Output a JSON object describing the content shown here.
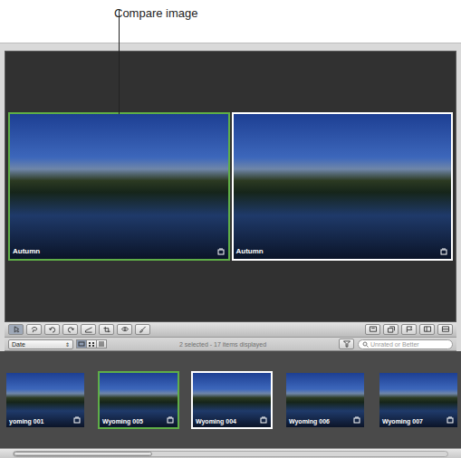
{
  "callout": {
    "label": "Compare image"
  },
  "viewer": {
    "images": [
      {
        "label": "Autumn",
        "compare": true,
        "selected": true
      },
      {
        "label": "Autumn",
        "compare": false,
        "selected": true
      }
    ]
  },
  "sort": {
    "value": "Date"
  },
  "view_modes": [
    {
      "selected": true
    },
    {
      "selected": false
    },
    {
      "selected": false
    }
  ],
  "status": "2 selected - 17 items displayed",
  "search": {
    "placeholder": "Unrated or Better"
  },
  "browser": {
    "thumbnails": [
      {
        "label": "yoming 001",
        "selected": false,
        "primary": false
      },
      {
        "label": "Wyoming 005",
        "selected": true,
        "primary": true
      },
      {
        "label": "Wyoming 004",
        "selected": true,
        "primary": false
      },
      {
        "label": "Wyoming 006",
        "selected": false,
        "primary": false
      },
      {
        "label": "Wyoming 007",
        "selected": false,
        "primary": false
      }
    ]
  },
  "scrollbar": {
    "level": 0.32
  }
}
